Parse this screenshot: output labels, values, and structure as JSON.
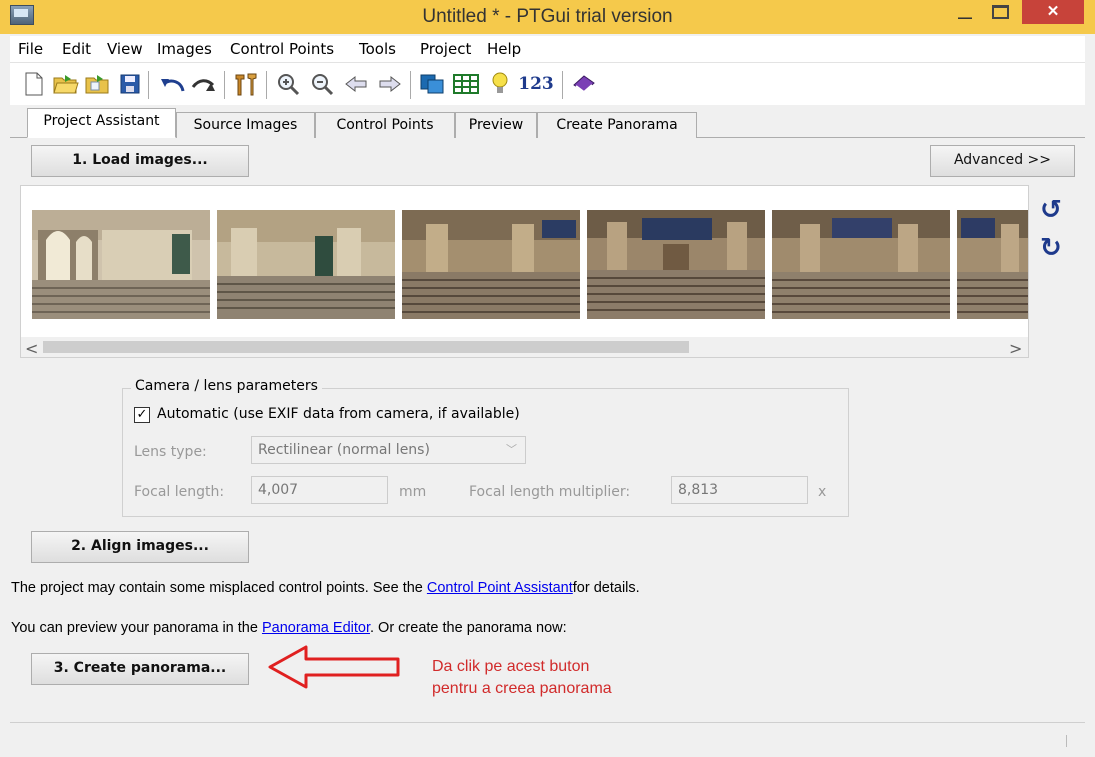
{
  "window": {
    "title": "Untitled * - PTGui trial version",
    "close_glyph": "✕",
    "min_glyph": "_"
  },
  "menu": [
    "File",
    "Edit",
    "View",
    "Images",
    "Control Points",
    "Tools",
    "Project",
    "Help"
  ],
  "toolbar": {
    "number_label": "123"
  },
  "tabs": [
    "Project Assistant",
    "Source Images",
    "Control Points",
    "Preview",
    "Create Panorama"
  ],
  "buttons": {
    "load": "1. Load images...",
    "advanced": "Advanced >>",
    "align": "2. Align images...",
    "create": "3. Create panorama..."
  },
  "scroll": {
    "left": "<",
    "right": ">"
  },
  "camera": {
    "legend": "Camera / lens parameters",
    "automatic_label": "Automatic (use EXIF data from camera, if available)",
    "automatic_checked": true,
    "check_glyph": "✓",
    "lens_type_label": "Lens type:",
    "lens_type_value": "Rectilinear (normal lens)",
    "focal_length_label": "Focal length:",
    "focal_length_value": "4,007",
    "focal_unit": "mm",
    "multiplier_label": "Focal length multiplier:",
    "multiplier_value": "8,813",
    "multiplier_unit": "x"
  },
  "messages": {
    "misplaced_pre": "The project may contain some misplaced control points. See the ",
    "misplaced_link": "Control Point Assistant",
    "misplaced_post": "for details.",
    "preview_pre": "You can preview your panorama in the ",
    "preview_link": "Panorama Editor",
    "preview_post": ". Or create the panorama now:"
  },
  "annotation": {
    "line1": "Da clik pe acest buton",
    "line2": "pentru a creea panorama",
    "color": "#d12b2b"
  },
  "colors": {
    "titlebar": "#f5c94b",
    "close": "#c7433a",
    "rotate_icons": "#1e3a8c"
  }
}
